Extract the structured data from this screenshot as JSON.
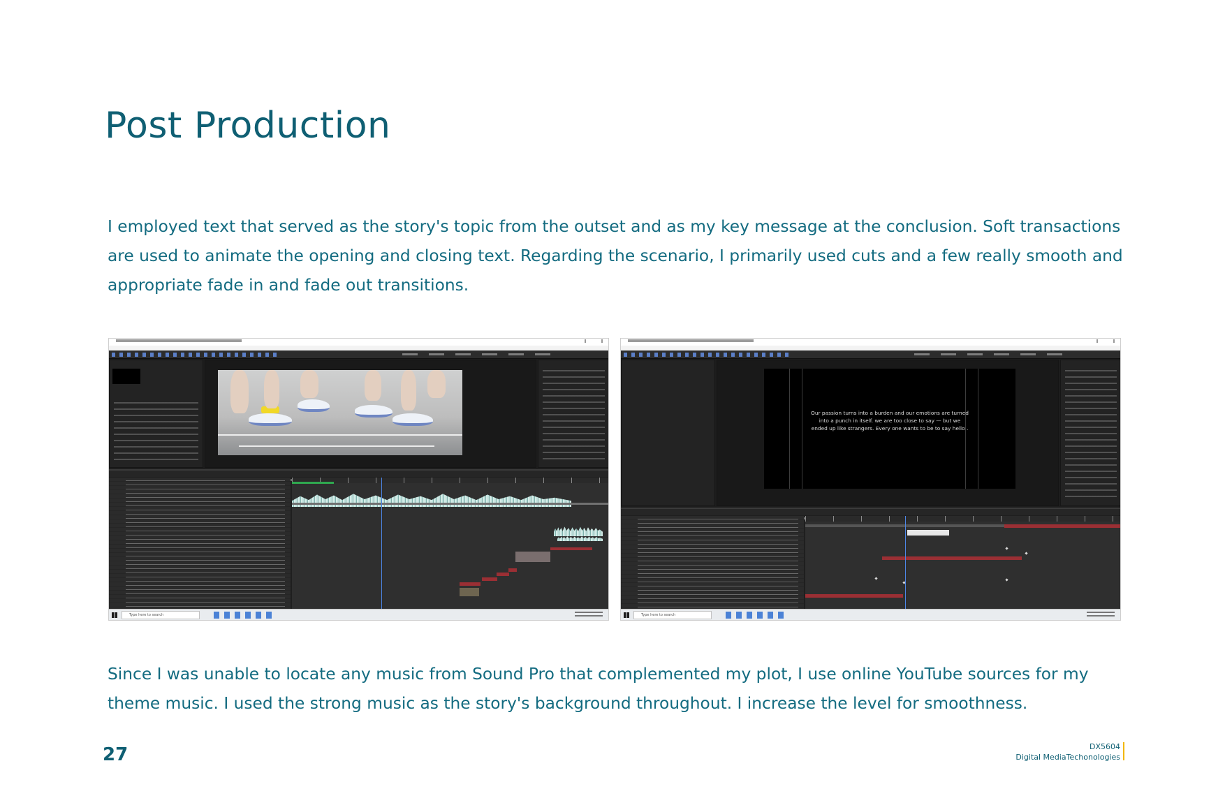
{
  "page": {
    "title": "Post Production",
    "paragraph_1": "I employed text that served as the story's topic from the outset and as my key message at the conclusion. Soft transactions are used to animate the opening and closing text. Regarding the scenario, I primarily used cuts and a few really smooth and appropriate fade in and fade out transitions.",
    "paragraph_2": "Since I was unable to locate any music from Sound Pro that complemented my plot, I use online YouTube sources for my theme music. I used the strong music as the story's background throughout. I increase the level for smoothness.",
    "page_number": "27"
  },
  "footer": {
    "course_code": "DX5604",
    "course_name": "Digital MediaTechonologies",
    "accent_color": "#f2b705"
  },
  "screenshots": {
    "left": {
      "app": "Adobe After Effects",
      "preview_content": "running legs with white sneakers and yellow socks",
      "search_placeholder": "Type here to search"
    },
    "right": {
      "app": "Adobe After Effects",
      "caption_line_1": "Our passion turns into a burden and our emotions are turned",
      "caption_line_2": "into a punch in itself. we are too close to say — but we",
      "caption_line_3": "ended up like strangers. Every one wants to be to say hello .",
      "search_placeholder": "Type here to search"
    }
  },
  "colors": {
    "heading": "#0f5f73",
    "body_text": "#136b80",
    "app_background": "#1d1d1d",
    "waveform": "#bfe0dc",
    "playhead": "#4d86e6",
    "layer_bar_red": "#9b2f34"
  }
}
